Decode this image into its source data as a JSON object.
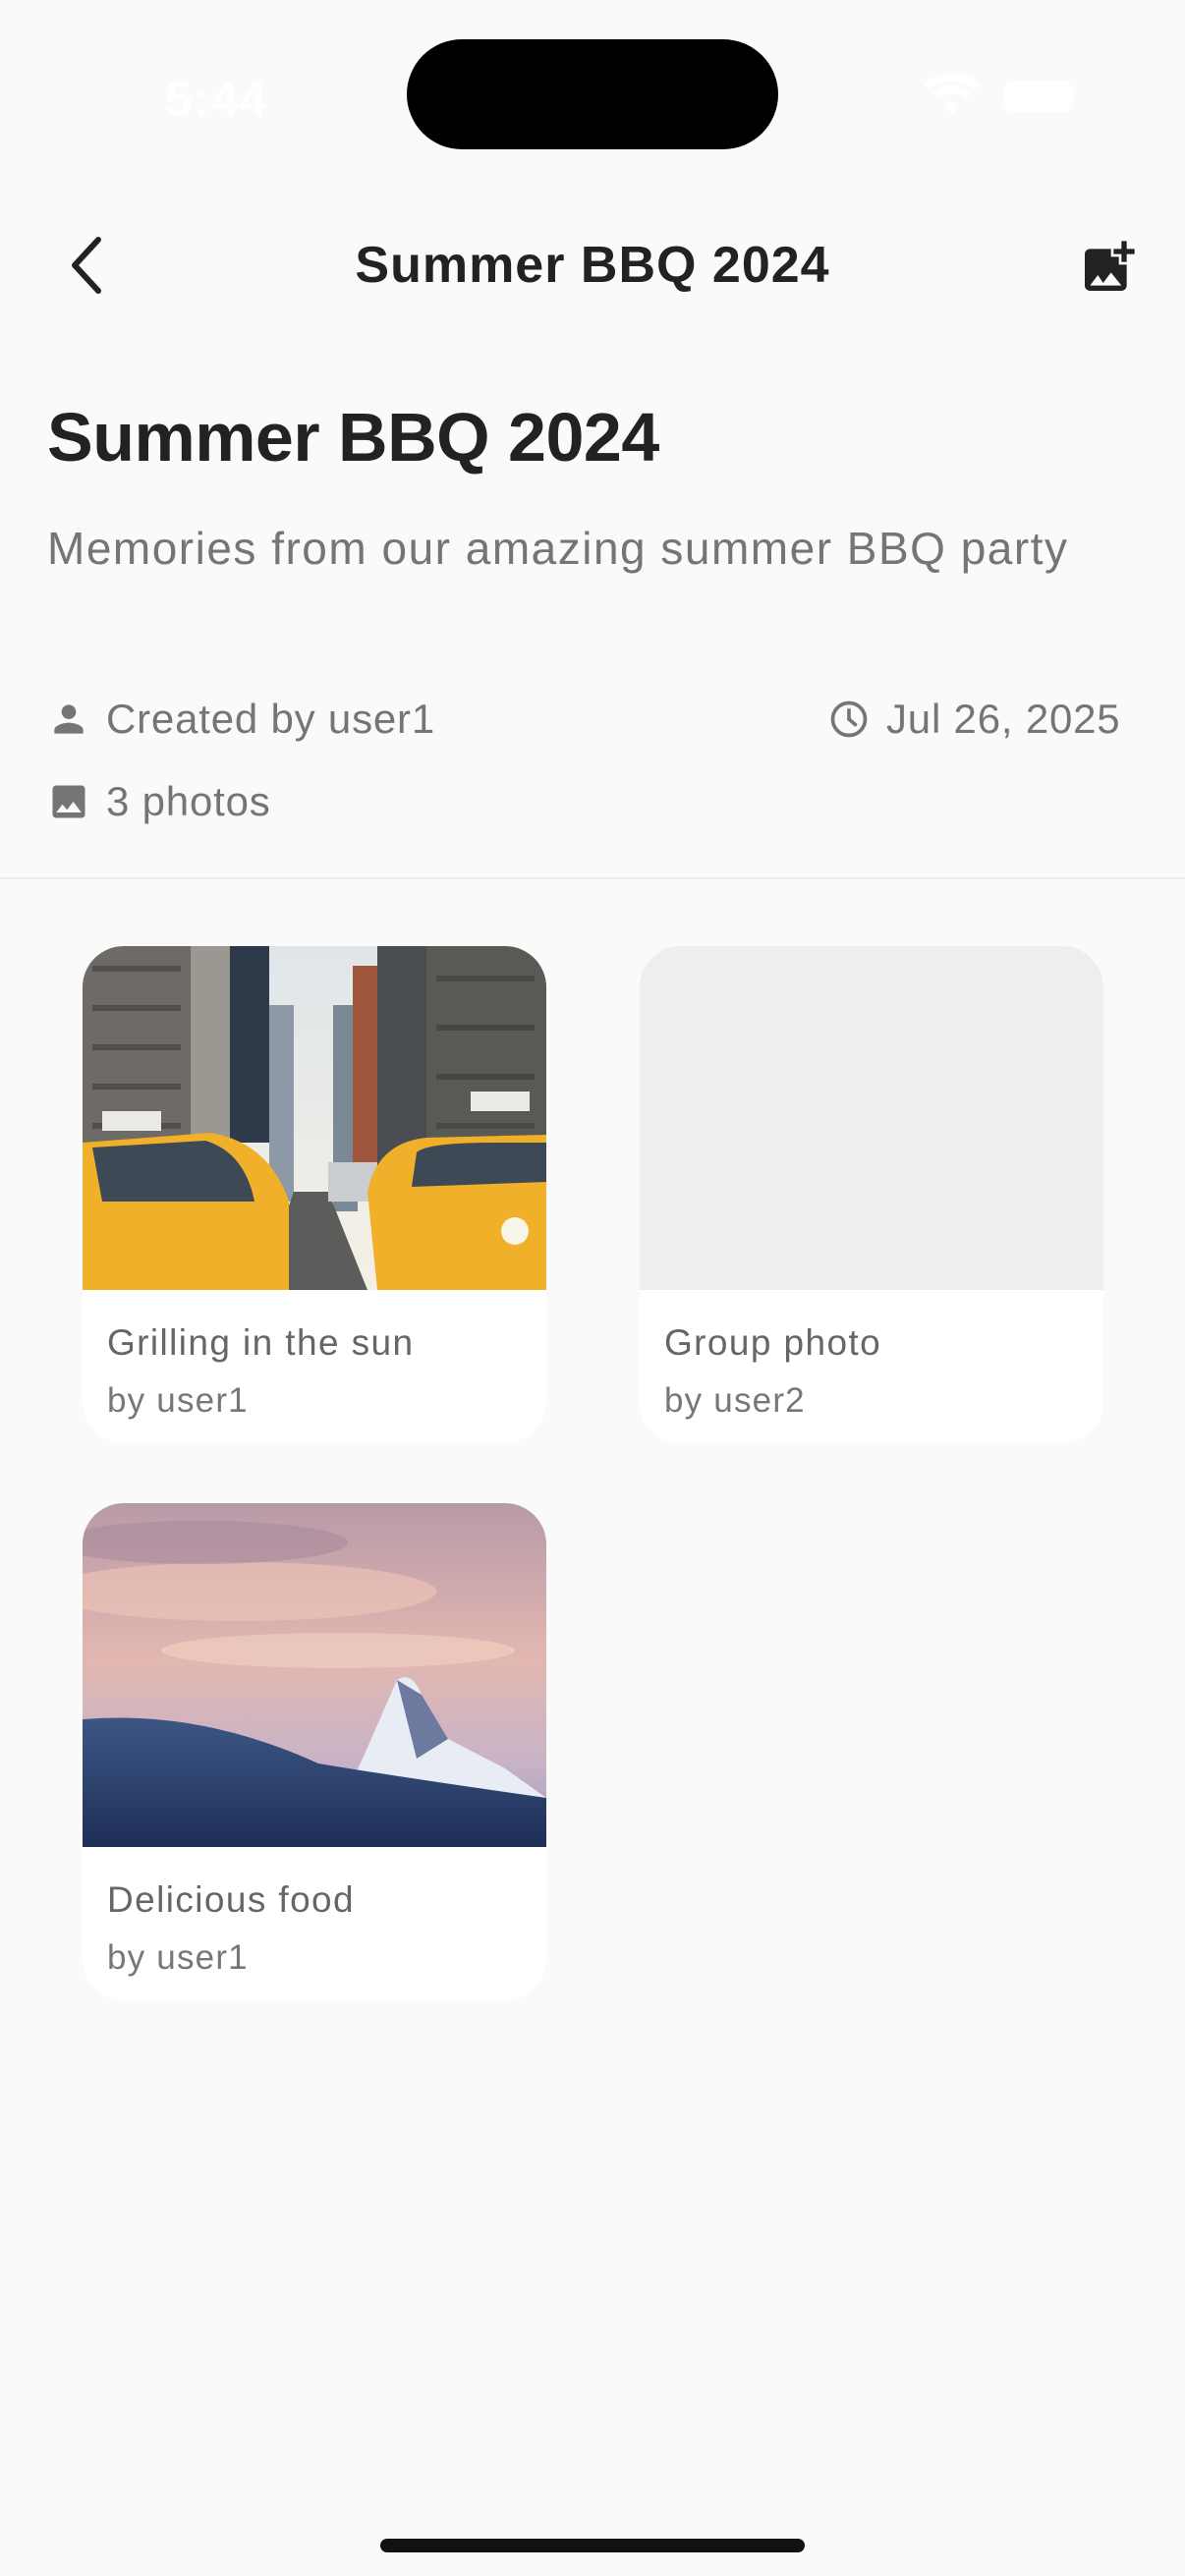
{
  "status_bar": {
    "time": "5:44"
  },
  "header": {
    "title": "Summer BBQ 2024",
    "back_icon": "chevron-left-icon",
    "add_icon": "add-photo-icon"
  },
  "album": {
    "title": "Summer BBQ 2024",
    "description": "Memories from our amazing summer BBQ party",
    "created_by": "Created by user1",
    "date": "Jul 26, 2025",
    "photo_count": "3 photos"
  },
  "photos": [
    {
      "caption": "Grilling in the sun",
      "author": "by user1",
      "image": "city-street-taxis"
    },
    {
      "caption": "Group photo",
      "author": "by user2",
      "image": "placeholder"
    },
    {
      "caption": "Delicious food",
      "author": "by user1",
      "image": "snowy-mountain-sunset"
    }
  ],
  "colors": {
    "background": "#fafafa",
    "card": "#ffffff",
    "placeholder": "#eeeeee",
    "primary_text": "#222222",
    "secondary_text": "#757575"
  }
}
